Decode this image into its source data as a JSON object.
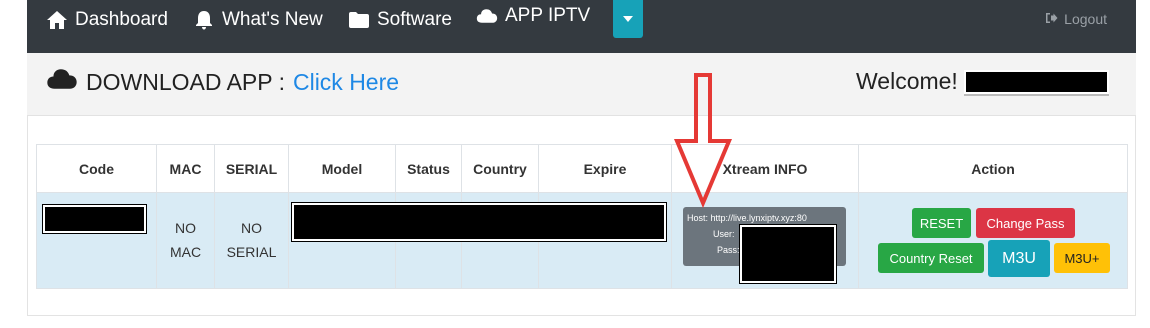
{
  "nav": {
    "dashboard": "Dashboard",
    "whats_new": "What's New",
    "software": "Software",
    "app_iptv": "APP IPTV",
    "logout": "Logout"
  },
  "subheader": {
    "download_label": "DOWNLOAD APP :",
    "download_link": "Click Here",
    "welcome": "Welcome!"
  },
  "table": {
    "headers": [
      "Code",
      "MAC",
      "SERIAL",
      "Model",
      "Status",
      "Country",
      "Expire",
      "Xtream INFO",
      "Action"
    ],
    "row": {
      "mac_line1": "NO",
      "mac_line2": "MAC",
      "serial_line1": "NO",
      "serial_line2": "SERIAL",
      "xtream": {
        "host": "Host: http://live.lynxiptv.xyz:80",
        "user": "User:",
        "pass": "Pass:"
      }
    }
  },
  "actions": {
    "reset": "RESET",
    "change_pass": "Change Pass",
    "country_reset": "Country Reset",
    "m3u": "M3U",
    "m3u_plus": "M3U+"
  },
  "colors": {
    "navbar": "#343a40",
    "accent_info": "#17a2b8",
    "success": "#28a745",
    "danger": "#dc3545",
    "warning": "#ffc107",
    "link": "#1e88e5",
    "row_bg": "#d9ebf5",
    "annotation_arrow": "#e53935"
  },
  "icons": {
    "dashboard": "home-icon",
    "whats_new": "bell-icon",
    "software": "folder-icon",
    "app_iptv": "cloud-icon",
    "logout": "sign-out-icon",
    "download": "cloud-icon"
  }
}
